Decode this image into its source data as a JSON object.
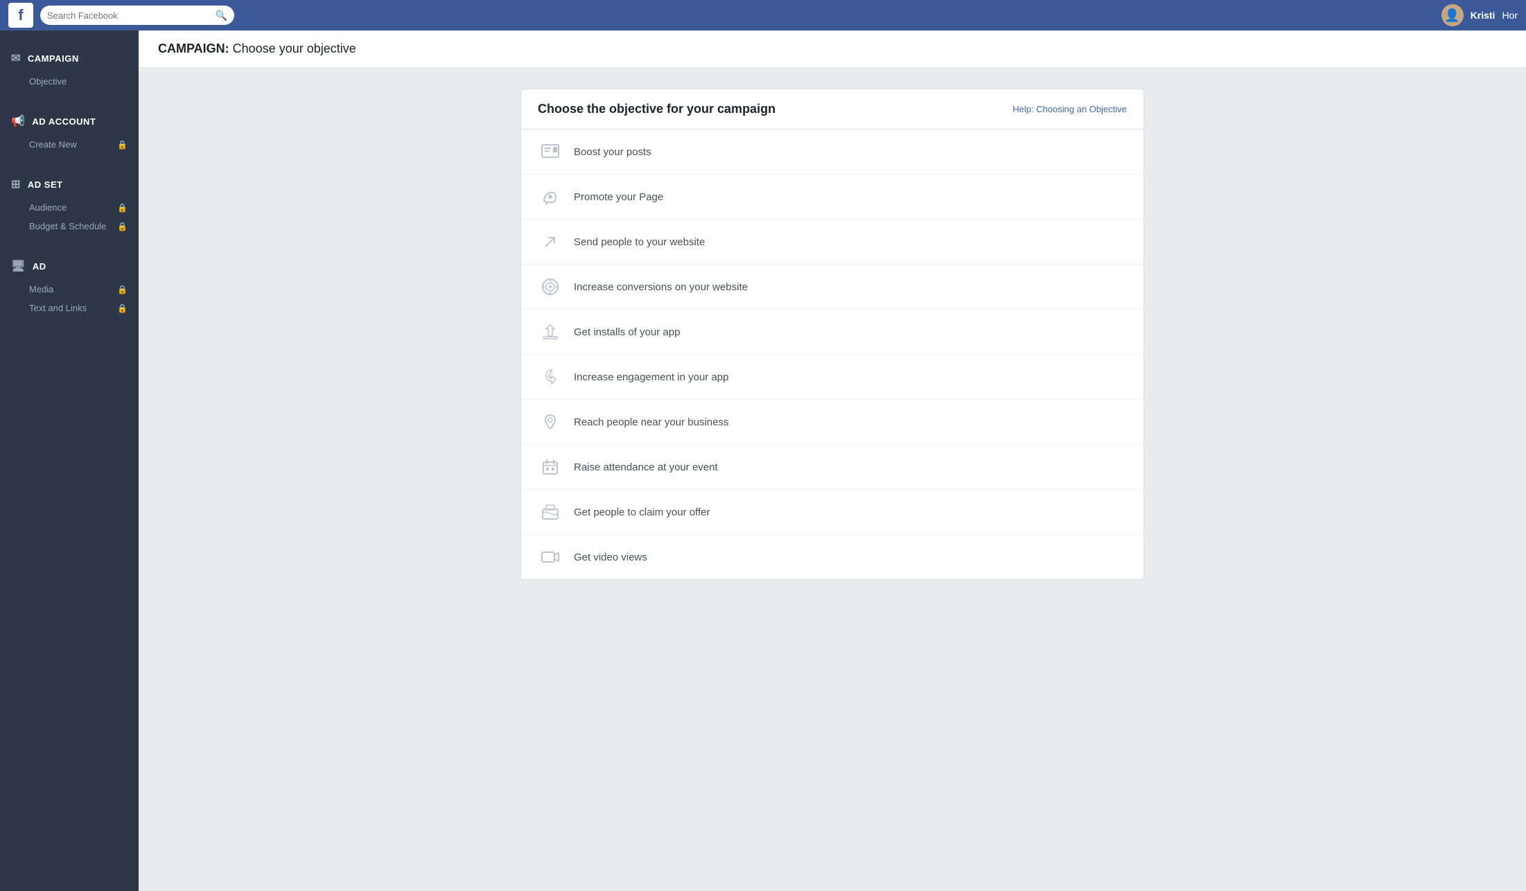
{
  "topNav": {
    "logo": "f",
    "searchPlaceholder": "Search Facebook",
    "userName": "Kristi",
    "navMore": "Hor"
  },
  "pageHeader": {
    "prefix": "CAMPAIGN:",
    "title": "Choose your objective"
  },
  "sidebar": {
    "sections": [
      {
        "id": "campaign",
        "label": "CAMPAIGN",
        "icon": "✉",
        "items": [
          {
            "label": "Objective",
            "locked": false
          }
        ]
      },
      {
        "id": "ad-account",
        "label": "AD ACCOUNT",
        "icon": "📢",
        "items": [
          {
            "label": "Create New",
            "locked": true
          }
        ]
      },
      {
        "id": "ad-set",
        "label": "AD SET",
        "icon": "⊞",
        "items": [
          {
            "label": "Audience",
            "locked": true
          },
          {
            "label": "Budget & Schedule",
            "locked": true
          }
        ]
      },
      {
        "id": "ad",
        "label": "AD",
        "icon": "🖥",
        "items": [
          {
            "label": "Media",
            "locked": true
          },
          {
            "label": "Text and Links",
            "locked": true
          }
        ]
      }
    ]
  },
  "objectiveCard": {
    "title": "Choose the objective for your campaign",
    "helpLink": "Help: Choosing an Objective",
    "objectives": [
      {
        "id": "boost-posts",
        "label": "Boost your posts",
        "icon": "📋"
      },
      {
        "id": "promote-page",
        "label": "Promote your Page",
        "icon": "👍"
      },
      {
        "id": "send-website",
        "label": "Send people to your website",
        "icon": "↗"
      },
      {
        "id": "increase-conversions",
        "label": "Increase conversions on your website",
        "icon": "🌐"
      },
      {
        "id": "app-installs",
        "label": "Get installs of your app",
        "icon": "📦"
      },
      {
        "id": "app-engagement",
        "label": "Increase engagement in your app",
        "icon": "🔑"
      },
      {
        "id": "reach-local",
        "label": "Reach people near your business",
        "icon": "📍"
      },
      {
        "id": "raise-attendance",
        "label": "Raise attendance at your event",
        "icon": "🗓"
      },
      {
        "id": "claim-offer",
        "label": "Get people to claim your offer",
        "icon": "🏷"
      },
      {
        "id": "video-views",
        "label": "Get video views",
        "icon": "📹"
      }
    ]
  }
}
